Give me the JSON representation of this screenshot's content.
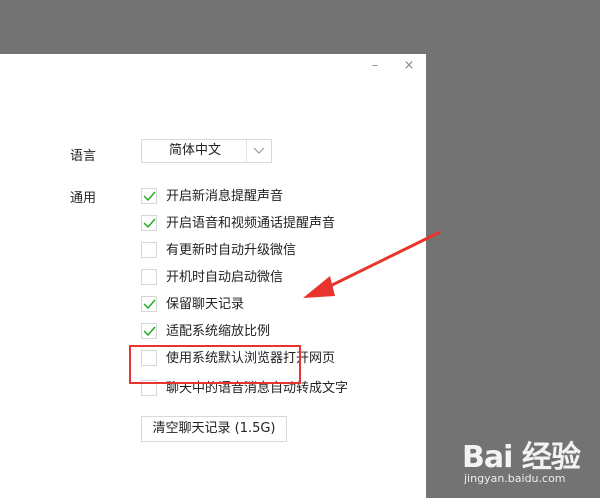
{
  "window": {
    "minimize_glyph": "–",
    "close_glyph": "×"
  },
  "language": {
    "label": "语言",
    "selected": "简体中文"
  },
  "general": {
    "label": "通用",
    "options": [
      {
        "label": "开启新消息提醒声音",
        "checked": true
      },
      {
        "label": "开启语音和视频通话提醒声音",
        "checked": true
      },
      {
        "label": "有更新时自动升级微信",
        "checked": false
      },
      {
        "label": "开机时自动启动微信",
        "checked": false
      },
      {
        "label": "保留聊天记录",
        "checked": true
      },
      {
        "label": "适配系统缩放比例",
        "checked": true
      },
      {
        "label": "使用系统默认浏览器打开网页",
        "checked": false
      },
      {
        "label": "聊天中的语音消息自动转成文字",
        "checked": false
      }
    ],
    "clear_button": "清空聊天记录 (1.5G)"
  },
  "colors": {
    "check": "#1aad19",
    "highlight": "#e8342c",
    "backdrop": "#737373"
  },
  "watermark": {
    "logo": "Bai 经验",
    "url": "jingyan.baidu.com"
  }
}
